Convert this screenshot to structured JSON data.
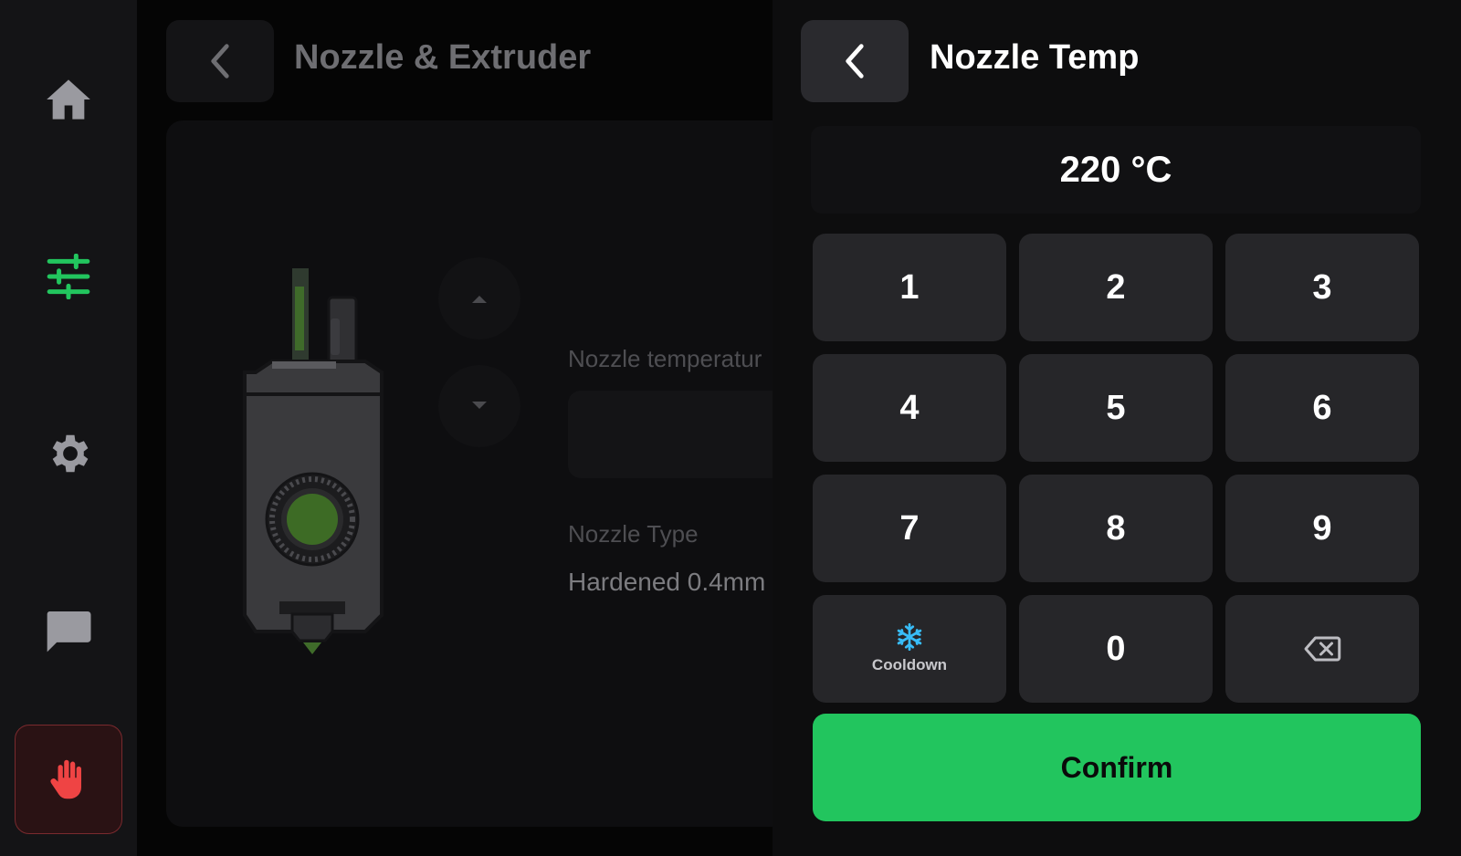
{
  "colors": {
    "accent": "#22c55e",
    "danger": "#ef4444",
    "cooldown": "#38bdf8",
    "key_bg": "#262629"
  },
  "sidebar": {
    "items": [
      {
        "icon": "home-icon"
      },
      {
        "icon": "tune-icon",
        "active": true
      },
      {
        "icon": "gear-icon"
      },
      {
        "icon": "chat-icon"
      },
      {
        "icon": "hand-stop-icon"
      }
    ]
  },
  "left_panel": {
    "title": "Nozzle & Extruder",
    "nozzle_temperature_label": "Nozzle temperatur",
    "nozzle_type_label": "Nozzle Type",
    "nozzle_type_value": "Hardened 0.4mm"
  },
  "keypad_panel": {
    "title": "Nozzle Temp",
    "display_value": "220 °C",
    "keys": {
      "k1": "1",
      "k2": "2",
      "k3": "3",
      "k4": "4",
      "k5": "5",
      "k6": "6",
      "k7": "7",
      "k8": "8",
      "k9": "9",
      "k0": "0"
    },
    "cooldown_label": "Cooldown",
    "confirm_label": "Confirm"
  }
}
